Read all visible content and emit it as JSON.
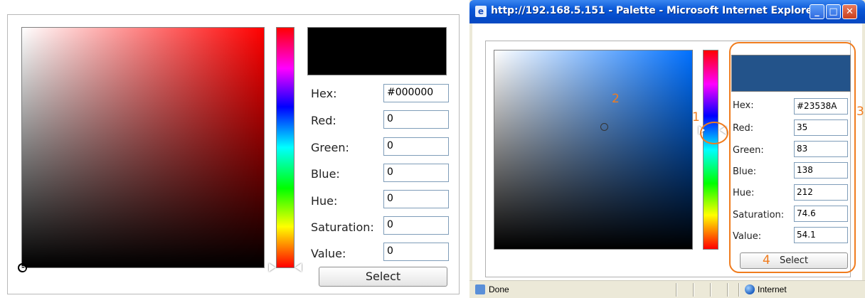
{
  "left_palette": {
    "fields": [
      {
        "label": "Hex:",
        "value": "#000000"
      },
      {
        "label": "Red:",
        "value": "0"
      },
      {
        "label": "Green:",
        "value": "0"
      },
      {
        "label": "Blue:",
        "value": "0"
      },
      {
        "label": "Hue:",
        "value": "0"
      },
      {
        "label": "Saturation:",
        "value": "0"
      },
      {
        "label": "Value:",
        "value": "0"
      }
    ],
    "select_label": "Select",
    "preview_color": "#000000"
  },
  "window": {
    "title": "http://192.168.5.151 - Palette - Microsoft Internet Explorer",
    "minimize_label": "_",
    "maximize_label": "□",
    "close_label": "✕"
  },
  "right_palette": {
    "fields": [
      {
        "label": "Hex:",
        "value": "#23538A"
      },
      {
        "label": "Red:",
        "value": "35"
      },
      {
        "label": "Green:",
        "value": "83"
      },
      {
        "label": "Blue:",
        "value": "138"
      },
      {
        "label": "Hue:",
        "value": "212"
      },
      {
        "label": "Saturation:",
        "value": "74.6"
      },
      {
        "label": "Value:",
        "value": "54.1"
      }
    ],
    "select_label": "Select",
    "preview_color": "#23538A"
  },
  "annotations": {
    "n1": "1",
    "n2": "2",
    "n3": "3",
    "n4": "4"
  },
  "statusbar": {
    "status_text": "Done",
    "zone_text": "Internet"
  }
}
